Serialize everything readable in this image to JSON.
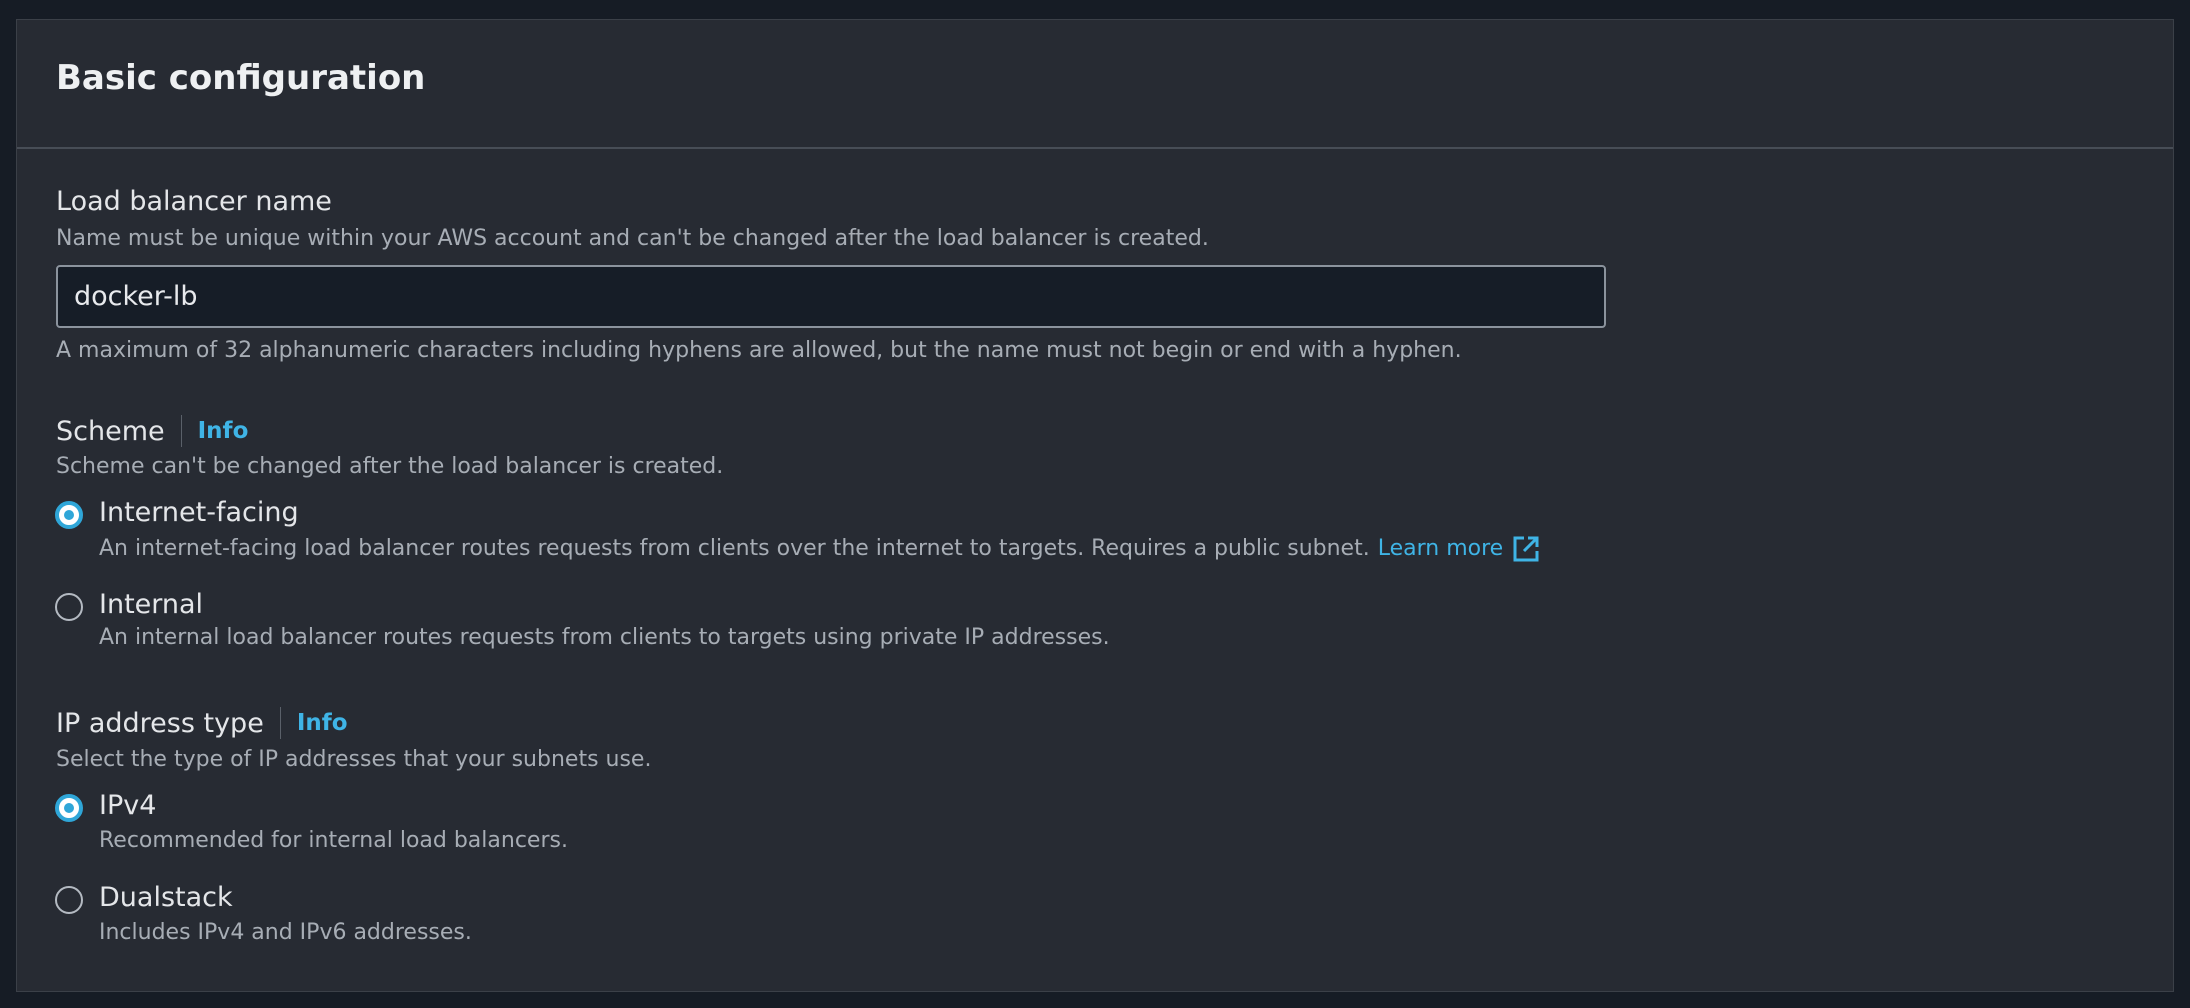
{
  "section": {
    "title": "Basic configuration"
  },
  "load_balancer_name": {
    "label": "Load balancer name",
    "description": "Name must be unique within your AWS account and can't be changed after the load balancer is created.",
    "value": "docker-lb",
    "constraint": "A maximum of 32 alphanumeric characters including hyphens are allowed, but the name must not begin or end with a hyphen."
  },
  "scheme": {
    "label": "Scheme",
    "info_label": "Info",
    "description": "Scheme can't be changed after the load balancer is created.",
    "options": [
      {
        "title": "Internet-facing",
        "description": "An internet-facing load balancer routes requests from clients over the internet to targets. Requires a public subnet.",
        "link_text": "Learn more",
        "link_icon": "external-link-icon",
        "selected": true
      },
      {
        "title": "Internal",
        "description": "An internal load balancer routes requests from clients to targets using private IP addresses.",
        "selected": false
      }
    ]
  },
  "ip_address_type": {
    "label": "IP address type",
    "info_label": "Info",
    "description": "Select the type of IP addresses that your subnets use.",
    "options": [
      {
        "title": "IPv4",
        "description": "Recommended for internal load balancers.",
        "selected": true
      },
      {
        "title": "Dualstack",
        "description": "Includes IPv4 and IPv6 addresses.",
        "selected": false
      }
    ]
  },
  "colors": {
    "background": "#161c25",
    "panel": "#272b33",
    "accent": "#2fa6d8",
    "link": "#3fb4e6",
    "text_primary": "#e4e6e9",
    "text_secondary": "#a7adb5"
  }
}
